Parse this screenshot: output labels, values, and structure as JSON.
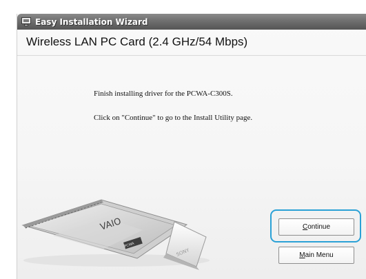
{
  "window": {
    "title": "Easy Installation Wizard",
    "icon": "computer-icon"
  },
  "header": {
    "product_title": "Wireless LAN PC Card (2.4 GHz/54 Mbps)"
  },
  "main": {
    "message_1": "Finish installing driver for the PCWA-C300S.",
    "message_2": "Click on \"Continue\" to go to the Install Utility page."
  },
  "buttons": {
    "continue": {
      "mnemonic": "C",
      "rest": "ontinue"
    },
    "main_menu": {
      "mnemonic": "M",
      "rest": "ain Menu"
    }
  },
  "card_image": {
    "brand_logo": "VAIO",
    "maker_text": "SONY",
    "label_text": "PCWA"
  },
  "colors": {
    "focus_ring": "#2aa1d6",
    "titlebar": "#6f6f6f"
  }
}
